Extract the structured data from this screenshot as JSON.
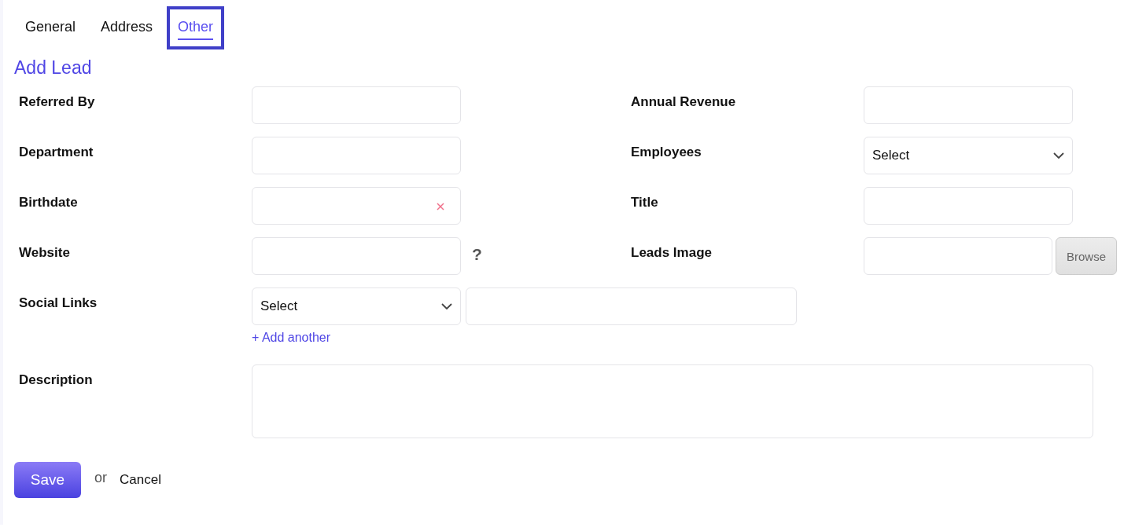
{
  "tabs": [
    {
      "label": "General",
      "selected": false,
      "focused": false
    },
    {
      "label": "Address",
      "selected": false,
      "focused": false
    },
    {
      "label": "Other",
      "selected": true,
      "focused": true
    }
  ],
  "heading": "Add Lead",
  "rows": [
    {
      "left": {
        "label": "Referred By",
        "kind": "text"
      },
      "right": {
        "label": "Annual Revenue",
        "kind": "text"
      }
    },
    {
      "left": {
        "label": "Department",
        "kind": "text"
      },
      "right": {
        "label": "Employees",
        "kind": "select",
        "value": "Select"
      }
    },
    {
      "left": {
        "label": "Birthdate",
        "kind": "date"
      },
      "right": {
        "label": "Title",
        "kind": "text"
      }
    },
    {
      "left": {
        "label": "Website",
        "kind": "text"
      },
      "help_text": "?",
      "right": {
        "label": "Leads Image",
        "kind": "file",
        "button": "Browse"
      }
    }
  ],
  "social": {
    "label": "Social Links",
    "select": "Select",
    "add_link": "+ Add another"
  },
  "description": {
    "label": "Description"
  },
  "actions": {
    "save": "Save",
    "or": "or",
    "cancel": "Cancel"
  }
}
